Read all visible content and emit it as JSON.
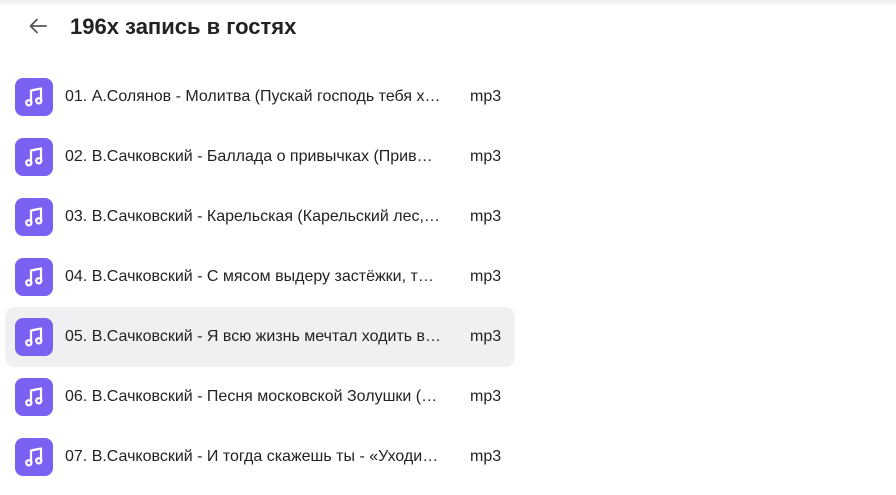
{
  "header": {
    "title": "196х запись в гостях",
    "back_icon": "arrow-left-icon"
  },
  "colors": {
    "file_icon_bg": "#7b61f2",
    "selected_row_bg": "#f0f0f2"
  },
  "files": [
    {
      "name": "01. А.Солянов - Молитва (Пускай господь тебя х…",
      "ext": "mp3",
      "icon": "music-note-icon"
    },
    {
      "name": "02. В.Сачковский - Баллада о привычках (Прив…",
      "ext": "mp3",
      "icon": "music-note-icon"
    },
    {
      "name": "03. В.Сачковский - Карельская (Карельский лес,…",
      "ext": "mp3",
      "icon": "music-note-icon"
    },
    {
      "name": "04. В.Сачковский - С мясом выдеру застёжки, т…",
      "ext": "mp3",
      "icon": "music-note-icon"
    },
    {
      "name": "05. В.Сачковский - Я всю жизнь мечтал ходить в…",
      "ext": "mp3",
      "icon": "music-note-icon",
      "selected": true
    },
    {
      "name": "06. В.Сачковский - Песня московской Золушки (…",
      "ext": "mp3",
      "icon": "music-note-icon"
    },
    {
      "name": "07. В.Сачковский - И тогда скажешь ты - «Уходи…",
      "ext": "mp3",
      "icon": "music-note-icon"
    }
  ]
}
